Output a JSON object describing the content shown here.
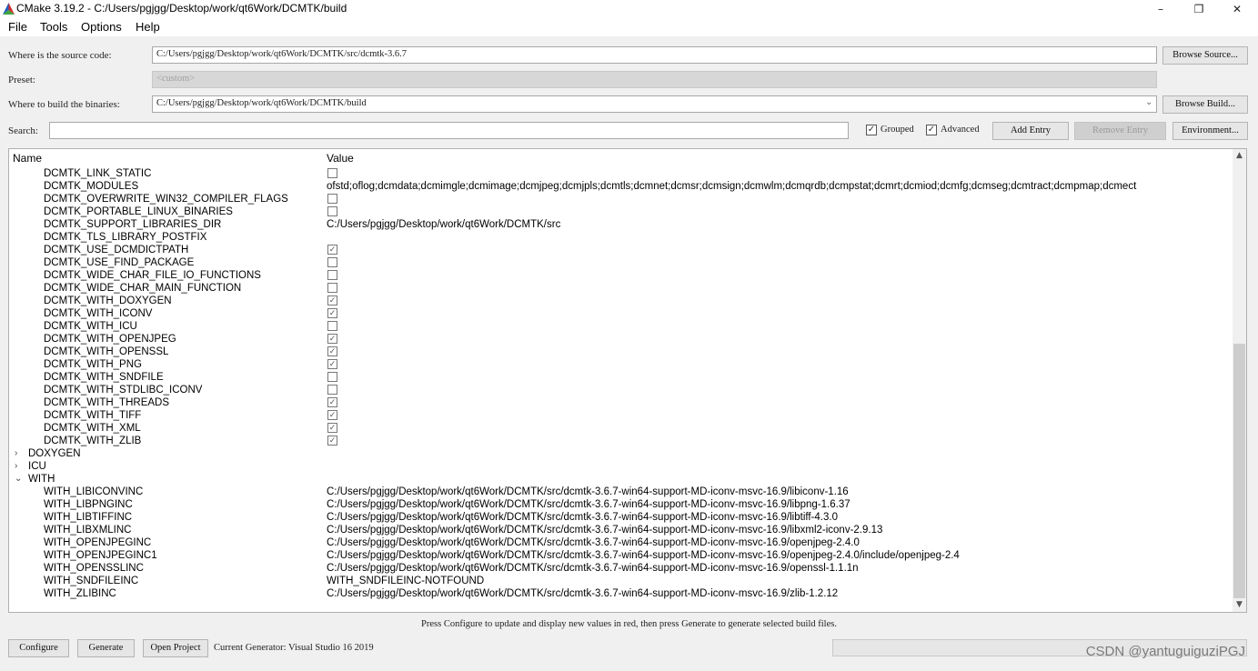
{
  "window": {
    "title": "CMake 3.19.2 - C:/Users/pgjgg/Desktop/work/qt6Work/DCMTK/build",
    "minimize": "–",
    "restore": "❐",
    "close": "✕"
  },
  "menu": [
    "File",
    "Tools",
    "Options",
    "Help"
  ],
  "source": {
    "label": "Where is the source code:",
    "value": "C:/Users/pgjgg/Desktop/work/qt6Work/DCMTK/src/dcmtk-3.6.7",
    "button": "Browse Source..."
  },
  "preset": {
    "label": "Preset:",
    "value": "<custom>"
  },
  "build": {
    "label": "Where to build the binaries:",
    "value": "C:/Users/pgjgg/Desktop/work/qt6Work/DCMTK/build",
    "button": "Browse Build..."
  },
  "search": {
    "label": "Search:",
    "value": ""
  },
  "options": {
    "grouped": "Grouped",
    "grouped_checked": true,
    "advanced": "Advanced",
    "advanced_checked": true,
    "add_entry": "Add Entry",
    "remove_entry": "Remove Entry",
    "environment": "Environment..."
  },
  "table": {
    "col_name": "Name",
    "col_value": "Value",
    "rows": [
      {
        "kind": "item",
        "name": "DCMTK_LINK_STATIC",
        "type": "bool",
        "checked": false
      },
      {
        "kind": "item",
        "name": "DCMTK_MODULES",
        "type": "text",
        "value": "ofstd;oflog;dcmdata;dcmimgle;dcmimage;dcmjpeg;dcmjpls;dcmtls;dcmnet;dcmsr;dcmsign;dcmwlm;dcmqrdb;dcmpstat;dcmrt;dcmiod;dcmfg;dcmseg;dcmtract;dcmpmap;dcmect"
      },
      {
        "kind": "item",
        "name": "DCMTK_OVERWRITE_WIN32_COMPILER_FLAGS",
        "type": "bool",
        "checked": false
      },
      {
        "kind": "item",
        "name": "DCMTK_PORTABLE_LINUX_BINARIES",
        "type": "bool",
        "checked": false
      },
      {
        "kind": "item",
        "name": "DCMTK_SUPPORT_LIBRARIES_DIR",
        "type": "text",
        "value": "C:/Users/pgjgg/Desktop/work/qt6Work/DCMTK/src"
      },
      {
        "kind": "item",
        "name": "DCMTK_TLS_LIBRARY_POSTFIX",
        "type": "text",
        "value": ""
      },
      {
        "kind": "item",
        "name": "DCMTK_USE_DCMDICTPATH",
        "type": "bool",
        "checked": true
      },
      {
        "kind": "item",
        "name": "DCMTK_USE_FIND_PACKAGE",
        "type": "bool",
        "checked": false
      },
      {
        "kind": "item",
        "name": "DCMTK_WIDE_CHAR_FILE_IO_FUNCTIONS",
        "type": "bool",
        "checked": false
      },
      {
        "kind": "item",
        "name": "DCMTK_WIDE_CHAR_MAIN_FUNCTION",
        "type": "bool",
        "checked": false
      },
      {
        "kind": "item",
        "name": "DCMTK_WITH_DOXYGEN",
        "type": "bool",
        "checked": true
      },
      {
        "kind": "item",
        "name": "DCMTK_WITH_ICONV",
        "type": "bool",
        "checked": true
      },
      {
        "kind": "item",
        "name": "DCMTK_WITH_ICU",
        "type": "bool",
        "checked": false
      },
      {
        "kind": "item",
        "name": "DCMTK_WITH_OPENJPEG",
        "type": "bool",
        "checked": true
      },
      {
        "kind": "item",
        "name": "DCMTK_WITH_OPENSSL",
        "type": "bool",
        "checked": true
      },
      {
        "kind": "item",
        "name": "DCMTK_WITH_PNG",
        "type": "bool",
        "checked": true
      },
      {
        "kind": "item",
        "name": "DCMTK_WITH_SNDFILE",
        "type": "bool",
        "checked": false
      },
      {
        "kind": "item",
        "name": "DCMTK_WITH_STDLIBC_ICONV",
        "type": "bool",
        "checked": false
      },
      {
        "kind": "item",
        "name": "DCMTK_WITH_THREADS",
        "type": "bool",
        "checked": true
      },
      {
        "kind": "item",
        "name": "DCMTK_WITH_TIFF",
        "type": "bool",
        "checked": true
      },
      {
        "kind": "item",
        "name": "DCMTK_WITH_XML",
        "type": "bool",
        "checked": true
      },
      {
        "kind": "item",
        "name": "DCMTK_WITH_ZLIB",
        "type": "bool",
        "checked": true
      },
      {
        "kind": "group",
        "name": "DOXYGEN",
        "expanded": false,
        "arrow": "›"
      },
      {
        "kind": "group",
        "name": "ICU",
        "expanded": false,
        "arrow": "›"
      },
      {
        "kind": "group",
        "name": "WITH",
        "expanded": true,
        "arrow": "⌄"
      },
      {
        "kind": "item",
        "name": "WITH_LIBICONVINC",
        "type": "text",
        "value": "C:/Users/pgjgg/Desktop/work/qt6Work/DCMTK/src/dcmtk-3.6.7-win64-support-MD-iconv-msvc-16.9/libiconv-1.16"
      },
      {
        "kind": "item",
        "name": "WITH_LIBPNGINC",
        "type": "text",
        "value": "C:/Users/pgjgg/Desktop/work/qt6Work/DCMTK/src/dcmtk-3.6.7-win64-support-MD-iconv-msvc-16.9/libpng-1.6.37"
      },
      {
        "kind": "item",
        "name": "WITH_LIBTIFFINC",
        "type": "text",
        "value": "C:/Users/pgjgg/Desktop/work/qt6Work/DCMTK/src/dcmtk-3.6.7-win64-support-MD-iconv-msvc-16.9/libtiff-4.3.0"
      },
      {
        "kind": "item",
        "name": "WITH_LIBXMLINC",
        "type": "text",
        "value": "C:/Users/pgjgg/Desktop/work/qt6Work/DCMTK/src/dcmtk-3.6.7-win64-support-MD-iconv-msvc-16.9/libxml2-iconv-2.9.13"
      },
      {
        "kind": "item",
        "name": "WITH_OPENJPEGINC",
        "type": "text",
        "value": "C:/Users/pgjgg/Desktop/work/qt6Work/DCMTK/src/dcmtk-3.6.7-win64-support-MD-iconv-msvc-16.9/openjpeg-2.4.0"
      },
      {
        "kind": "item",
        "name": "WITH_OPENJPEGINC1",
        "type": "text",
        "value": "C:/Users/pgjgg/Desktop/work/qt6Work/DCMTK/src/dcmtk-3.6.7-win64-support-MD-iconv-msvc-16.9/openjpeg-2.4.0/include/openjpeg-2.4"
      },
      {
        "kind": "item",
        "name": "WITH_OPENSSLINC",
        "type": "text",
        "value": "C:/Users/pgjgg/Desktop/work/qt6Work/DCMTK/src/dcmtk-3.6.7-win64-support-MD-iconv-msvc-16.9/openssl-1.1.1n"
      },
      {
        "kind": "item",
        "name": "WITH_SNDFILEINC",
        "type": "text",
        "value": "WITH_SNDFILEINC-NOTFOUND"
      },
      {
        "kind": "item",
        "name": "WITH_ZLIBINC",
        "type": "text",
        "value": "C:/Users/pgjgg/Desktop/work/qt6Work/DCMTK/src/dcmtk-3.6.7-win64-support-MD-iconv-msvc-16.9/zlib-1.2.12"
      }
    ]
  },
  "hint": "Press Configure to update and display new values in red, then press Generate to generate selected build files.",
  "bottom": {
    "configure": "Configure",
    "generate": "Generate",
    "open_project": "Open Project",
    "generator": "Current Generator: Visual Studio 16 2019"
  },
  "watermark": "CSDN @yantuguiguziPGJ"
}
